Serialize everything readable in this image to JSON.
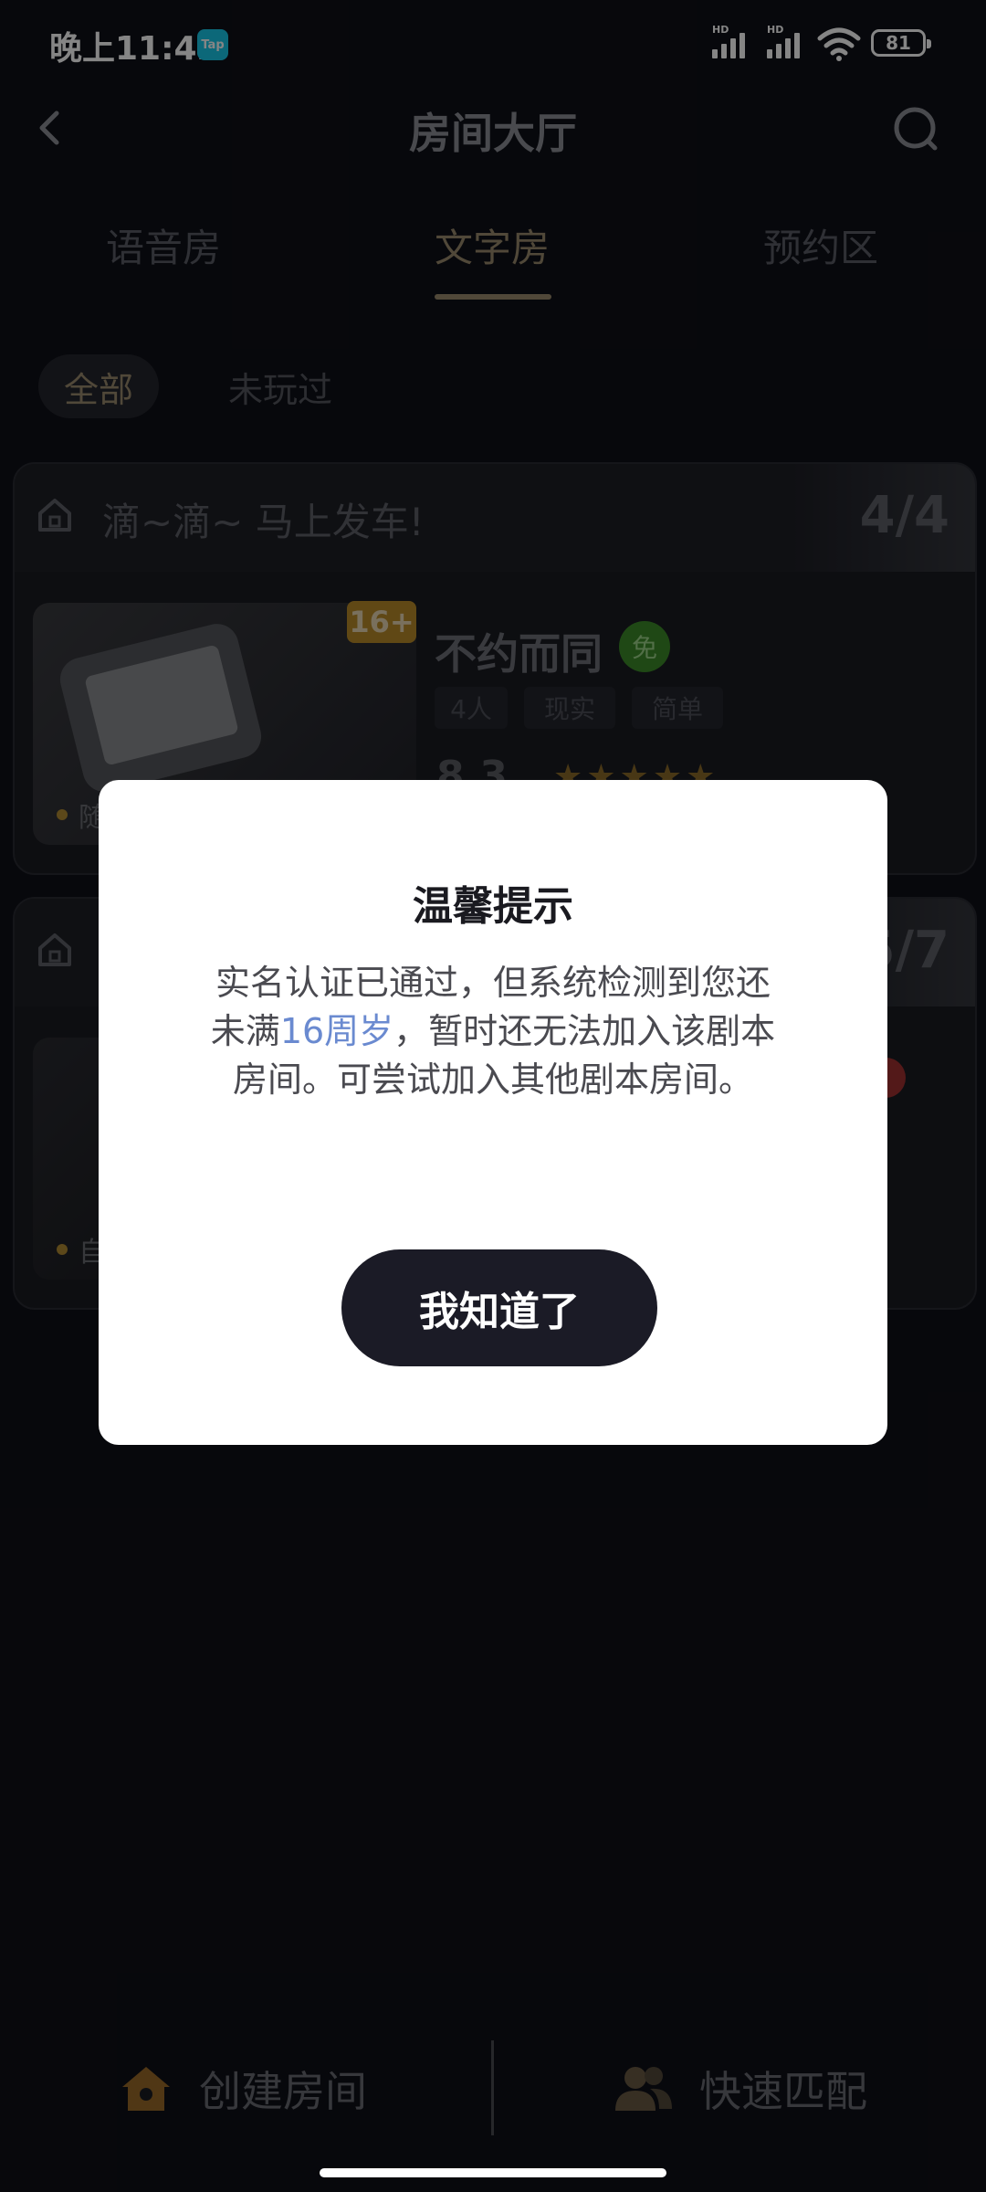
{
  "status_bar": {
    "time": "晚上11:42",
    "tap_badge": "Tap",
    "signal1_label": "HD",
    "signal2_label": "HD",
    "battery": "81"
  },
  "header": {
    "title": "房间大厅",
    "back_icon": "chevron-left-icon",
    "search_icon": "search-icon"
  },
  "tabs": [
    {
      "label": "语音房",
      "active": false
    },
    {
      "label": "文字房",
      "active": true
    },
    {
      "label": "预约区",
      "active": false
    }
  ],
  "filters": {
    "all": "全部",
    "not_played": "未玩过"
  },
  "rooms": [
    {
      "title": "滴~滴~ 马上发车!",
      "count": "4/4",
      "age": "16+",
      "script_name": "不约而同",
      "free_badge": "免",
      "tags": [
        "4人",
        "现实",
        "简单"
      ],
      "rating": "8.3",
      "stars": "★★★★★",
      "caption": "随"
    },
    {
      "count": "5/7",
      "caption": "自"
    }
  ],
  "modal": {
    "title": "温馨提示",
    "body_before": "实名认证已通过，但系统检测到您还未满",
    "body_highlight": "16周岁",
    "body_after": "，暂时还无法加入该剧本房间。可尝试加入其他剧本房间。",
    "confirm": "我知道了"
  },
  "bottom_bar": {
    "create_room": "创建房间",
    "quick_match": "快速匹配"
  },
  "colors": {
    "background": "#0f1017",
    "accent_gold": "#9a8a6d",
    "highlight_blue": "#6a8ad0",
    "button_dark": "#1b1b26"
  }
}
